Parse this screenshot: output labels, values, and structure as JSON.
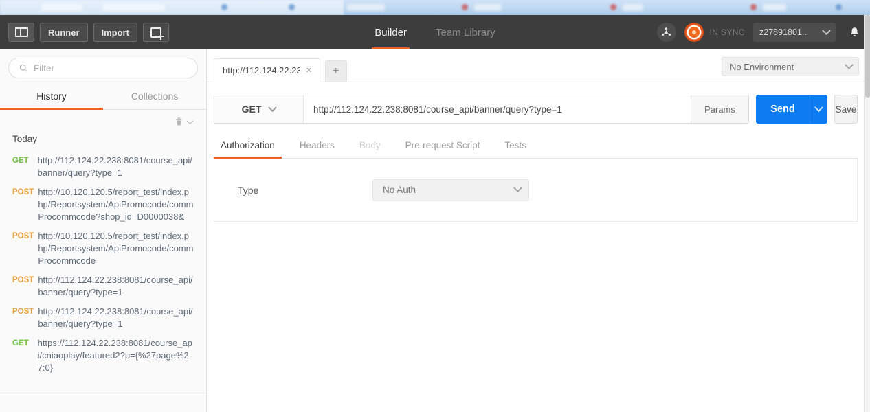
{
  "app": {
    "brand_orange": "#ec6123",
    "send_blue": "#0d7cf2",
    "topbar_bg": "#3d3d3d"
  },
  "topbar": {
    "sidebar_toggle_name": "sidebar-toggle",
    "runner_label": "Runner",
    "import_label": "Import",
    "new_tab_label": "",
    "tabs": [
      {
        "label": "Builder",
        "active": true
      },
      {
        "label": "Team Library",
        "active": false
      }
    ],
    "sync_status": "IN SYNC",
    "user_label": "z27891801..",
    "bell_glyph": "\u0000"
  },
  "sidebar": {
    "filter_placeholder": "Filter",
    "filter_value": "",
    "tabs": [
      {
        "label": "History",
        "active": true
      },
      {
        "label": "Collections",
        "active": false
      }
    ],
    "day_label": "Today",
    "history": [
      {
        "method": "GET",
        "url": "http://112.124.22.238:8081/course_api/banner/query?type=1"
      },
      {
        "method": "POST",
        "url": "http://10.120.120.5/report_test/index.php/Reportsystem/ApiPromocode/commProcommcode?shop_id=D0000038&"
      },
      {
        "method": "POST",
        "url": "http://10.120.120.5/report_test/index.php/Reportsystem/ApiPromocode/commProcommcode"
      },
      {
        "method": "POST",
        "url": "http://112.124.22.238:8081/course_api/banner/query?type=1"
      },
      {
        "method": "POST",
        "url": "http://112.124.22.238:8081/course_api/banner/query?type=1"
      },
      {
        "method": "GET",
        "url": "https://112.124.22.238:8081/course_api/cniaoplay/featured2?p={%27page%27:0}"
      }
    ]
  },
  "request": {
    "tab_title": "http://112.124.22.23",
    "tab_close_glyph": "×",
    "add_tab_glyph": "+",
    "environment": "No Environment",
    "method": "GET",
    "url": "http://112.124.22.238:8081/course_api/banner/query?type=1",
    "params_label": "Params",
    "send_label": "Send",
    "save_label": "Save",
    "option_tabs": [
      {
        "label": "Authorization",
        "state": "active"
      },
      {
        "label": "Headers",
        "state": "normal"
      },
      {
        "label": "Body",
        "state": "disabled"
      },
      {
        "label": "Pre-request Script",
        "state": "normal"
      },
      {
        "label": "Tests",
        "state": "normal"
      }
    ],
    "auth": {
      "type_label": "Type",
      "type_value": "No Auth"
    }
  }
}
